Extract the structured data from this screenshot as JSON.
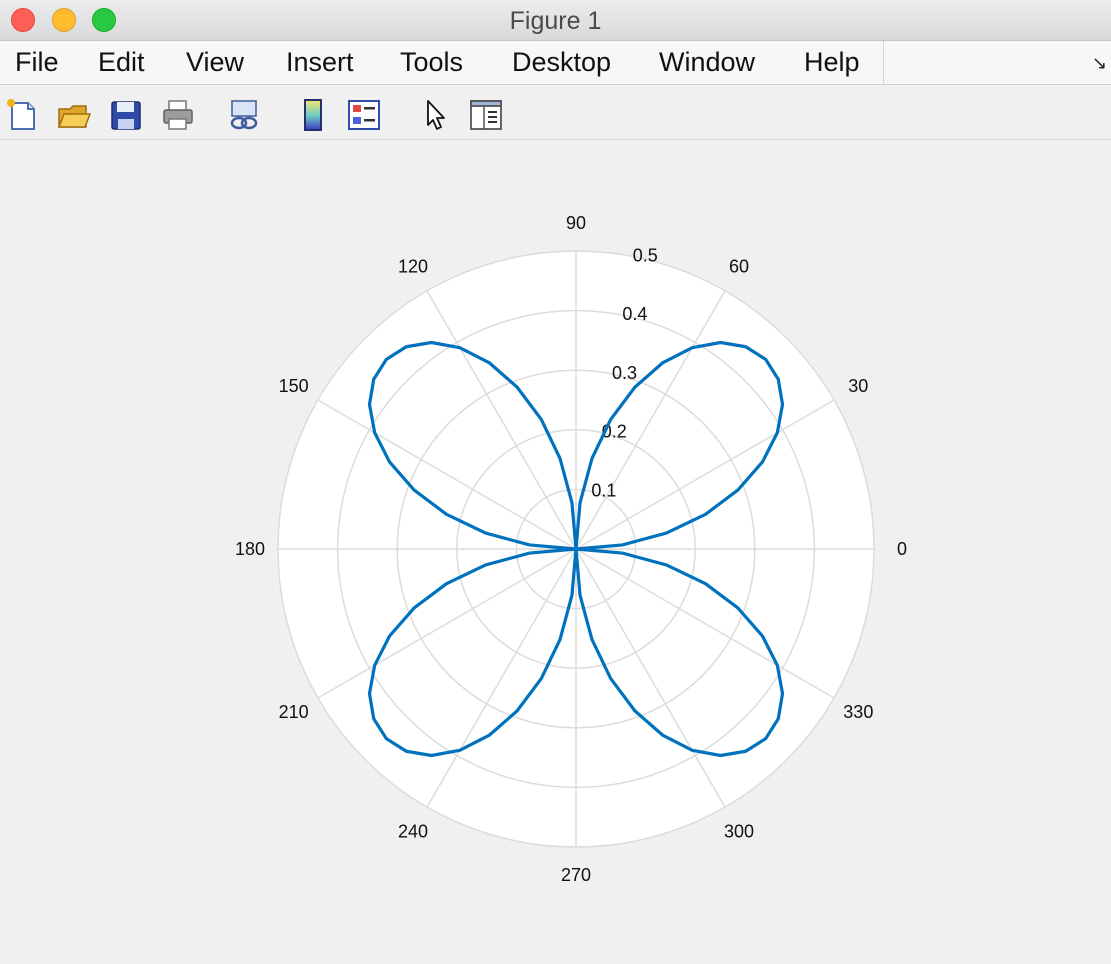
{
  "window": {
    "title": "Figure 1"
  },
  "menu": {
    "items": [
      "File",
      "Edit",
      "View",
      "Insert",
      "Tools",
      "Desktop",
      "Window",
      "Help"
    ]
  },
  "toolbar": {
    "icons": [
      "new-figure-icon",
      "open-file-icon",
      "save-icon",
      "print-icon",
      "link-plot-icon",
      "insert-colorbar-icon",
      "insert-legend-icon",
      "edit-plot-pointer-icon",
      "property-inspector-icon"
    ]
  },
  "chart_data": {
    "type": "polar",
    "title": "",
    "theta_ticks": [
      "0",
      "30",
      "60",
      "90",
      "120",
      "150",
      "180",
      "210",
      "240",
      "270",
      "300",
      "330"
    ],
    "r_ticks": [
      "0.1",
      "0.2",
      "0.3",
      "0.4",
      "0.5"
    ],
    "rlim": [
      0,
      0.5
    ],
    "grid": true,
    "series": [
      {
        "function": "r = |sin(2θ)| · 0.45",
        "theta_deg": [
          0,
          5,
          10,
          15,
          20,
          25,
          30,
          35,
          40,
          45,
          50,
          55,
          60,
          65,
          70,
          75,
          80,
          85,
          90
        ],
        "r": [
          0,
          0.078,
          0.154,
          0.225,
          0.289,
          0.345,
          0.39,
          0.423,
          0.443,
          0.45,
          0.443,
          0.423,
          0.39,
          0.345,
          0.289,
          0.225,
          0.154,
          0.078,
          0
        ],
        "symmetry": "four-fold (pattern repeats every 90°)",
        "color": "#0072bd"
      }
    ]
  }
}
